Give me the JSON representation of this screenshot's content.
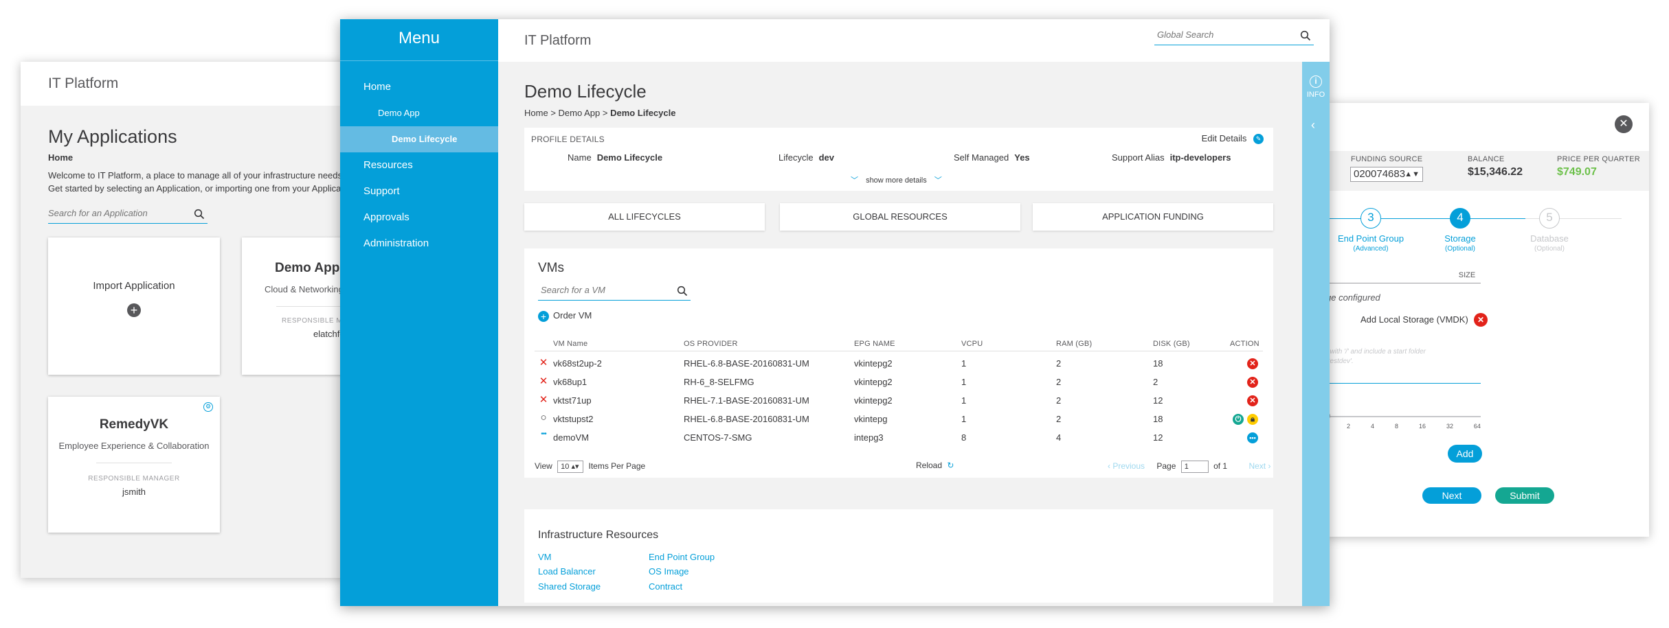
{
  "left_window": {
    "app_title": "IT Platform",
    "page_title": "My Applications",
    "breadcrumb": "Home",
    "welcome_line1": "Welcome to IT Platform, a place to manage all of your infrastructure needs. Cl",
    "welcome_line2": "Get started by selecting an Application, or importing one from your Applicatio",
    "search_placeholder": "Search for an Application",
    "import_card": {
      "label": "Import Application"
    },
    "demo_card": {
      "title": "Demo Appl",
      "subtitle": "Cloud & Networking",
      "rm_label": "RESPONSIBLE M",
      "rm_value": "elatchfo"
    },
    "remedy_card": {
      "title": "RemedyVK",
      "subtitle": "Employee Experience & Collaboration",
      "rm_label": "RESPONSIBLE MANAGER",
      "rm_value": "jsmith"
    }
  },
  "right_window": {
    "funding_source_label": "FUNDING SOURCE",
    "funding_source_value": "020074683",
    "balance_label": "BALANCE",
    "balance_value": "$15,346.22",
    "price_label": "PRICE PER QUARTER",
    "price_value": "$749.07",
    "steps": [
      {
        "num": "3",
        "label": "End Point Group",
        "sub": "(Advanced)"
      },
      {
        "num": "4",
        "label": "Storage",
        "sub": "(Optional)"
      },
      {
        "num": "5",
        "label": "Database",
        "sub": "(Optional)"
      }
    ],
    "size_header": "SIZE",
    "configured_text": "ge configured",
    "add_storage_label": "Add Local Storage (VMDK)",
    "hint_line1": "t with '/' and include a start folder",
    "hint_line2": "/testdev'.",
    "slider_ticks": [
      "2",
      "4",
      "8",
      "16",
      "32",
      "64"
    ],
    "add_button": "Add",
    "next_button": "Next",
    "submit_button": "Submit"
  },
  "front_window": {
    "menu_title": "Menu",
    "menu_items": [
      {
        "label": "Home"
      },
      {
        "label": "Demo App"
      },
      {
        "label": "Demo Lifecycle"
      },
      {
        "label": "Resources"
      },
      {
        "label": "Support"
      },
      {
        "label": "Approvals"
      },
      {
        "label": "Administration"
      }
    ],
    "app_title": "IT Platform",
    "global_search_placeholder": "Global Search",
    "info_label": "INFO",
    "page_title": "Demo Lifecycle",
    "breadcrumb": {
      "home": "Home",
      "sep": ">",
      "app": "Demo App",
      "current": "Demo Lifecycle"
    },
    "profile": {
      "header": "PROFILE DETAILS",
      "edit_label": "Edit Details",
      "name_label": "Name",
      "name_value": "Demo Lifecycle",
      "lifecycle_label": "Lifecycle",
      "lifecycle_value": "dev",
      "self_managed_label": "Self Managed",
      "self_managed_value": "Yes",
      "alias_label": "Support Alias",
      "alias_value": "itp-developers",
      "show_more": "show more details"
    },
    "tabs": [
      "ALL LIFECYCLES",
      "GLOBAL RESOURCES",
      "APPLICATION FUNDING"
    ],
    "vms": {
      "title": "VMs",
      "search_placeholder": "Search for a VM",
      "order_label": "Order VM",
      "columns": [
        "VM Name",
        "OS PROVIDER",
        "EPG NAME",
        "VCPU",
        "RAM (GB)",
        "DISK (GB)",
        "ACTION"
      ],
      "rows": [
        {
          "status": "✕",
          "name": "vk68st2up-2",
          "os": "RHEL-6.8-BASE-20160831-UM",
          "epg": "vkintepg2",
          "vcpu": "1",
          "ram": "2",
          "disk": "18"
        },
        {
          "status": "✕",
          "name": "vk68up1",
          "os": "RH-6_8-SELFMG",
          "epg": "vkintepg2",
          "vcpu": "1",
          "ram": "2",
          "disk": "2"
        },
        {
          "status": "✕",
          "name": "vktst71up",
          "os": "RHEL-7.1-BASE-20160831-UM",
          "epg": "vkintepg2",
          "vcpu": "1",
          "ram": "2",
          "disk": "12"
        },
        {
          "status": "○",
          "name": "vktstupst2",
          "os": "RHEL-6.8-BASE-20160831-UM",
          "epg": "vkintepg",
          "vcpu": "1",
          "ram": "2",
          "disk": "18"
        },
        {
          "status": "•••",
          "name": "demoVM",
          "os": "CENTOS-7-SMG",
          "epg": "intepg3",
          "vcpu": "8",
          "ram": "4",
          "disk": "12"
        }
      ],
      "view_label": "View",
      "per_page_value": "10",
      "per_page_label": "Items Per Page",
      "reload_label": "Reload",
      "prev_label": "Previous",
      "page_label": "Page",
      "page_value": "1",
      "of_label": "of 1",
      "next_label": "Next"
    },
    "infra": {
      "title": "Infrastructure Resources",
      "links_col1": [
        "VM",
        "Load Balancer",
        "Shared Storage"
      ],
      "links_col2": [
        "End Point Group",
        "OS Image",
        "Contract"
      ]
    }
  },
  "colors": {
    "primary_blue": "#049fd9",
    "rail_blue": "#82cdea",
    "danger_red": "#e2231a",
    "success_green": "#14a792",
    "warning_yellow": "#ffcc00",
    "price_green": "#6cc04a"
  }
}
